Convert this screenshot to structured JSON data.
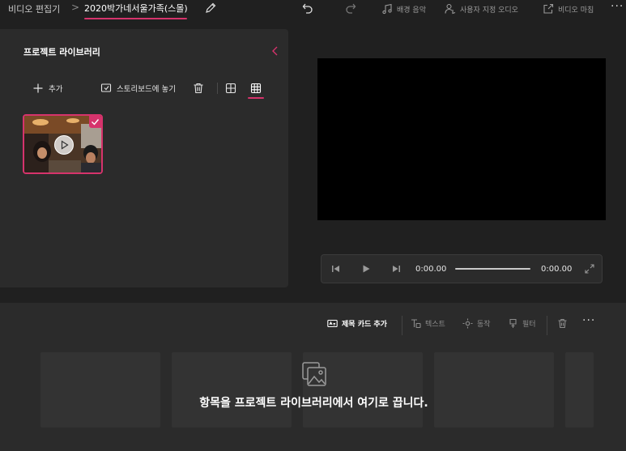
{
  "topbar": {
    "home_label": "비디오 편집기",
    "separator": ">",
    "project_name": "2020박가네서울가족(스몰)",
    "actions": {
      "background_music": "배경 음악",
      "custom_audio": "사용자 지정 오디오",
      "finish_video": "비디오 마침"
    },
    "more": "···"
  },
  "library": {
    "title": "프로젝트 라이브러리",
    "add_label": "추가",
    "place_storyboard_label": "스토리보드에 놓기",
    "items": [
      {
        "type": "video",
        "selected": true
      }
    ]
  },
  "player": {
    "current_time": "0:00.00",
    "total_time": "0:00.00",
    "progress": 0
  },
  "storyboard": {
    "toolbar": {
      "title_card": "제목 카드 추가",
      "text": "텍스트",
      "motion": "동작",
      "filters": "필터",
      "more": "···"
    },
    "drop_message": "항목을 프로젝트 라이브러리에서 여기로 끕니다."
  },
  "colors": {
    "accent": "#d6336c",
    "background": "#202020",
    "panel": "#2b2b2b"
  }
}
